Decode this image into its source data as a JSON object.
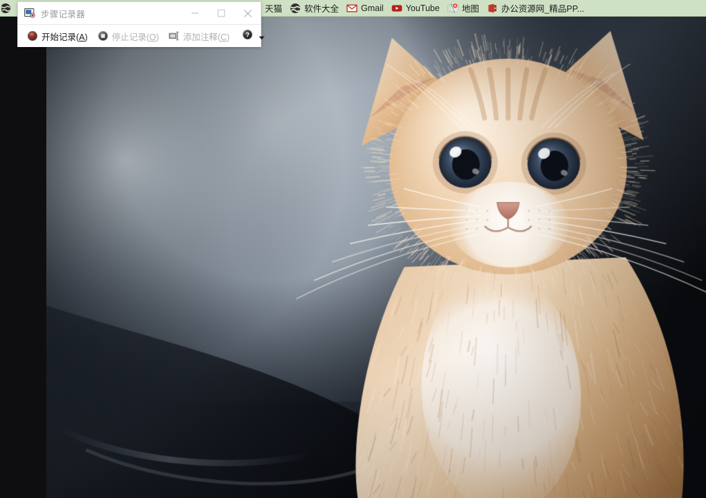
{
  "browser": {
    "bookmarks_bar": {
      "name": "bookmarks-bar",
      "background_color": "#cfe1c4",
      "items": [
        {
          "label": "",
          "icon": "globe-icon",
          "truncated_left": true
        },
        {
          "label": "天猫",
          "icon": "tmall-icon"
        },
        {
          "label": "软件大全",
          "icon": "globe-icon"
        },
        {
          "label": "Gmail",
          "icon": "gmail-icon"
        },
        {
          "label": "YouTube",
          "icon": "youtube-icon"
        },
        {
          "label": "地图",
          "icon": "maps-icon"
        },
        {
          "label": "办公资源网_精品PP...",
          "icon": "office-resource-icon"
        }
      ]
    }
  },
  "steps_recorder": {
    "title": "步骤记录器",
    "app_icon": "steps-recorder-icon",
    "window_controls": {
      "minimize": "—",
      "maximize": "□",
      "close": "✕"
    },
    "toolbar": {
      "start_record": {
        "label": "开始记录",
        "accelerator": "A",
        "icon": "record-circle-icon",
        "enabled": true
      },
      "stop_record": {
        "label": "停止记录",
        "accelerator": "O",
        "icon": "stop-square-icon",
        "enabled": false
      },
      "add_comment": {
        "label": "添加注释",
        "accelerator": "C",
        "icon": "add-comment-icon",
        "enabled": false
      },
      "help": {
        "label": "?",
        "icon": "help-icon"
      },
      "dropdown": {
        "label": "▾",
        "icon": "chevron-down-icon"
      }
    }
  },
  "desktop": {
    "wallpaper": {
      "name": "kitten-wallpaper",
      "description": "A ginger and white kitten with large blue-grey eyes sitting in front of a dark blurred background",
      "colors": {
        "backdrop_dark": "#191d26",
        "backdrop_light": "#c5ccd4",
        "fur_light": "#f3ddc4",
        "fur_mid": "#e0b58c",
        "fur_dark": "#b8804f",
        "eye": "#2b3a4d",
        "chest_white": "#f6f2ee"
      }
    },
    "left_margin_color": "#0e0e11"
  }
}
